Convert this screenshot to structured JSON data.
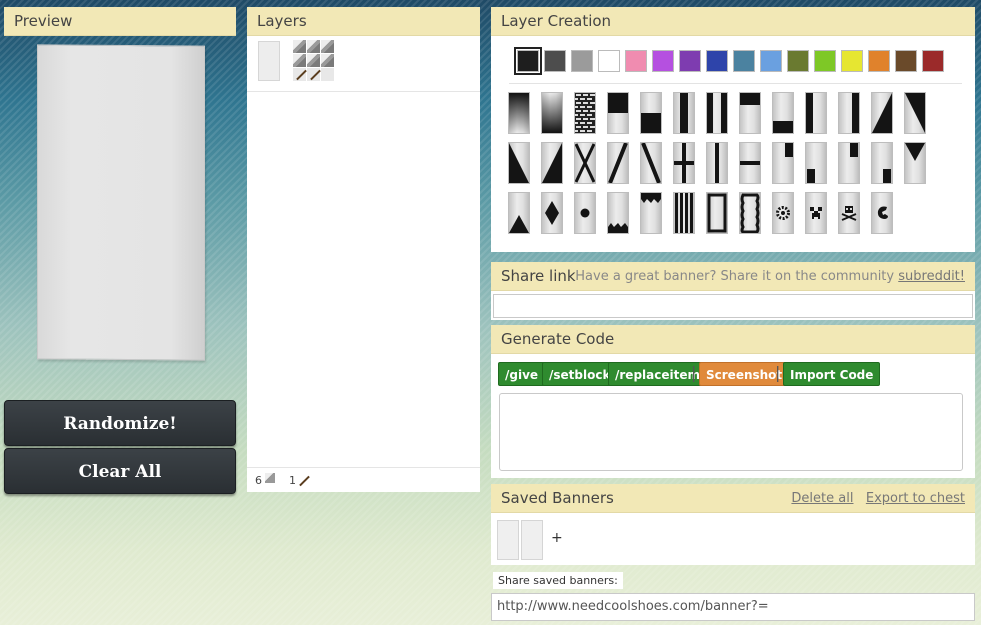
{
  "preview": {
    "title": "Preview"
  },
  "buttons": {
    "randomize": "Randomize!",
    "clear_all": "Clear All"
  },
  "layers": {
    "title": "Layers",
    "footer": {
      "wool_count": "6",
      "stick_count": "1"
    }
  },
  "layer_creation": {
    "title": "Layer Creation",
    "colors": [
      "#1e1e1e",
      "#4d4d4d",
      "#9b9b9b",
      "#ffffff",
      "#f08cb0",
      "#b550e0",
      "#7e3cb0",
      "#2e44aa",
      "#4b82a0",
      "#6aa0e0",
      "#6a7a30",
      "#7ec826",
      "#e6e631",
      "#e0822c",
      "#6a4a2a",
      "#9b2a2a"
    ],
    "selected_color": "#1e1e1e",
    "patterns": [
      "gradient-down",
      "gradient-up",
      "bricks",
      "half-top",
      "half-bottom",
      "stripe-center",
      "stripe-left-right",
      "stripe-top",
      "stripe-bottom",
      "stripe-left",
      "stripe-right",
      "diagonal-left",
      "diagonal-right",
      "triangle-left",
      "triangle-right",
      "cross",
      "stripe-downleft",
      "stripe-downright",
      "straight-cross",
      "stripe-center-v",
      "stripe-middle",
      "square-top-right",
      "square-bottom-right",
      "square-top-left",
      "square-bottom-left",
      "triangle-top",
      "triangle-bottom",
      "rhombus",
      "circle",
      "triangles-bottom",
      "triangles-top",
      "stripe-small",
      "border",
      "curly-border",
      "flower",
      "creeper",
      "skull",
      "mojang"
    ]
  },
  "share_link": {
    "title": "Share link",
    "prompt": "Have a great banner? Share it on the community",
    "link": "subreddit!",
    "value": ""
  },
  "generate_code": {
    "title": "Generate Code",
    "buttons": {
      "give": "/give",
      "setblock": "/setblock",
      "replaceitem": "/replaceitem",
      "screenshot": "Screenshot",
      "import": "Import Code"
    },
    "separator": "|",
    "output": ""
  },
  "saved_banners": {
    "title": "Saved Banners",
    "delete_all": "Delete all",
    "export": "Export to chest",
    "add": "+"
  },
  "share_saved": {
    "label": "Share saved banners:",
    "url": "http://www.needcoolshoes.com/banner?="
  }
}
